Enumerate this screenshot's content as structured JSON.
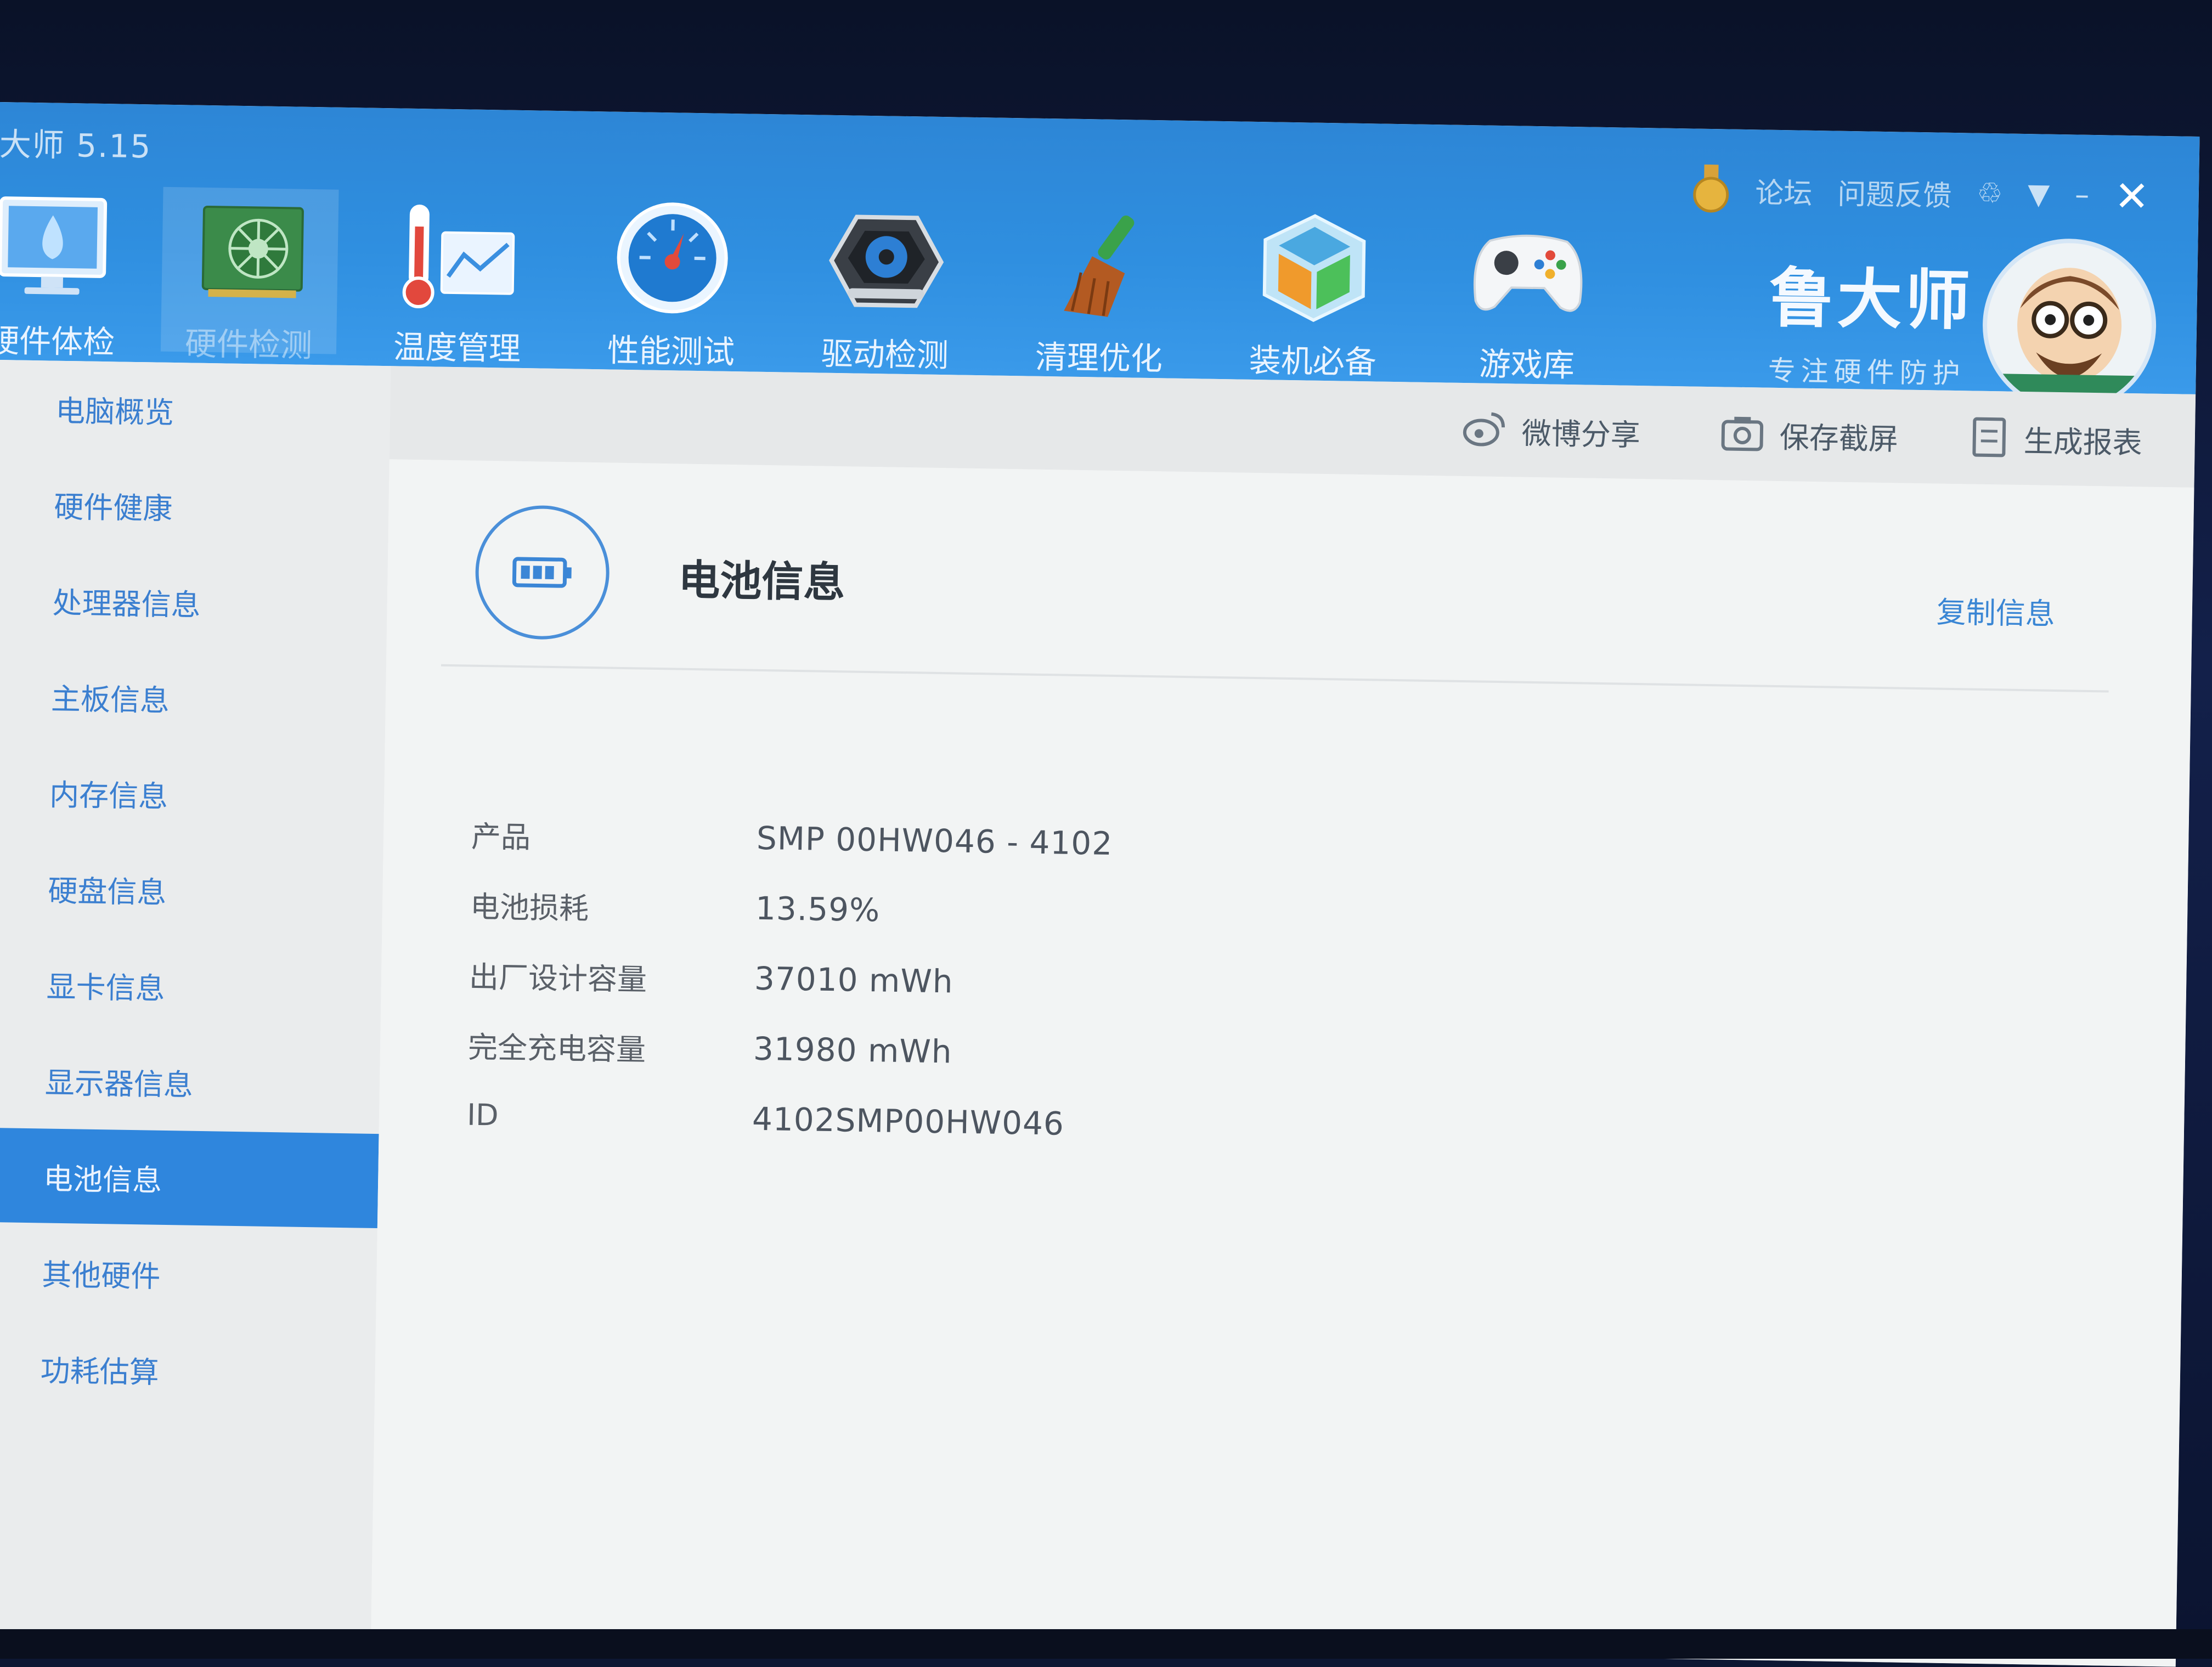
{
  "app": {
    "title": "大师 5.15"
  },
  "nav": [
    {
      "label": "硬件体检",
      "icon": "monitor-health-icon"
    },
    {
      "label": "硬件检测",
      "icon": "circuit-board-icon",
      "active": true
    },
    {
      "label": "温度管理",
      "icon": "thermometer-chart-icon"
    },
    {
      "label": "性能测试",
      "icon": "speedometer-icon"
    },
    {
      "label": "驱动检测",
      "icon": "gear-hexagon-icon"
    },
    {
      "label": "清理优化",
      "icon": "broom-icon"
    },
    {
      "label": "装机必备",
      "icon": "cube-box-icon"
    },
    {
      "label": "游戏库",
      "icon": "gamepad-icon"
    }
  ],
  "top_links": {
    "medal_icon": "medal-icon",
    "forum": "论坛",
    "feedback": "问题反馈",
    "share_icon": "recycle-icon",
    "menu_icon": "dropdown-menu-icon",
    "minimize": "–",
    "close": "✕"
  },
  "brand": {
    "name": "鲁大师",
    "slogan": "专注硬件防护"
  },
  "sidebar": [
    {
      "label": "电脑概览"
    },
    {
      "label": "硬件健康"
    },
    {
      "label": "处理器信息"
    },
    {
      "label": "主板信息"
    },
    {
      "label": "内存信息"
    },
    {
      "label": "硬盘信息"
    },
    {
      "label": "显卡信息"
    },
    {
      "label": "显示器信息"
    },
    {
      "label": "电池信息",
      "active": true
    },
    {
      "label": "其他硬件"
    },
    {
      "label": "功耗估算"
    }
  ],
  "toolbar": {
    "weibo_share": "微博分享",
    "save_screenshot": "保存截屏",
    "generate_report": "生成报表"
  },
  "section": {
    "title": "电池信息",
    "copy_info": "复制信息",
    "icon": "battery-icon"
  },
  "battery_info": [
    {
      "key": "产品",
      "value": "SMP 00HW046 -  4102"
    },
    {
      "key": "电池损耗",
      "value": "13.59%"
    },
    {
      "key": "出厂设计容量",
      "value": "37010 mWh"
    },
    {
      "key": "完全充电容量",
      "value": "31980 mWh"
    },
    {
      "key": "ID",
      "value": "4102SMP00HW046"
    }
  ],
  "colors": {
    "header_blue": "#2f8fe0",
    "active_blue": "#2f86dd",
    "link_blue": "#3a86d4"
  }
}
